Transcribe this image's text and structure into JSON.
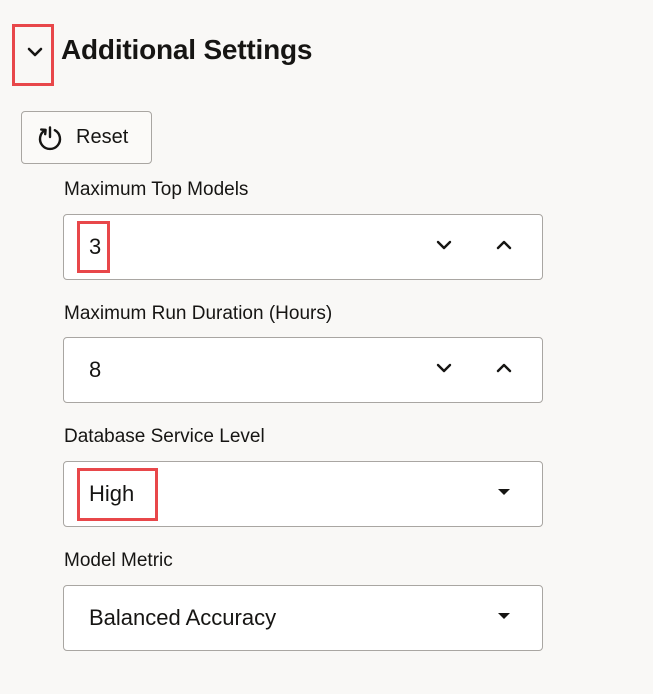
{
  "section": {
    "title": "Additional Settings"
  },
  "reset": {
    "label": "Reset"
  },
  "fields": {
    "max_top_models": {
      "label": "Maximum Top Models",
      "value": "3"
    },
    "max_run_duration": {
      "label": "Maximum Run Duration (Hours)",
      "value": "8"
    },
    "db_service_level": {
      "label": "Database Service Level",
      "value": "High"
    },
    "model_metric": {
      "label": "Model Metric",
      "value": "Balanced Accuracy"
    }
  },
  "icons": {
    "collapse": "chevron-down-icon",
    "reset": "power-reset-icon",
    "decrement": "chevron-down-icon",
    "increment": "chevron-up-icon",
    "dropdown": "caret-down-icon"
  },
  "colors": {
    "highlight": "#e8474a",
    "border": "#a9a6a2",
    "background": "#f9f8f6",
    "text": "#161513"
  }
}
